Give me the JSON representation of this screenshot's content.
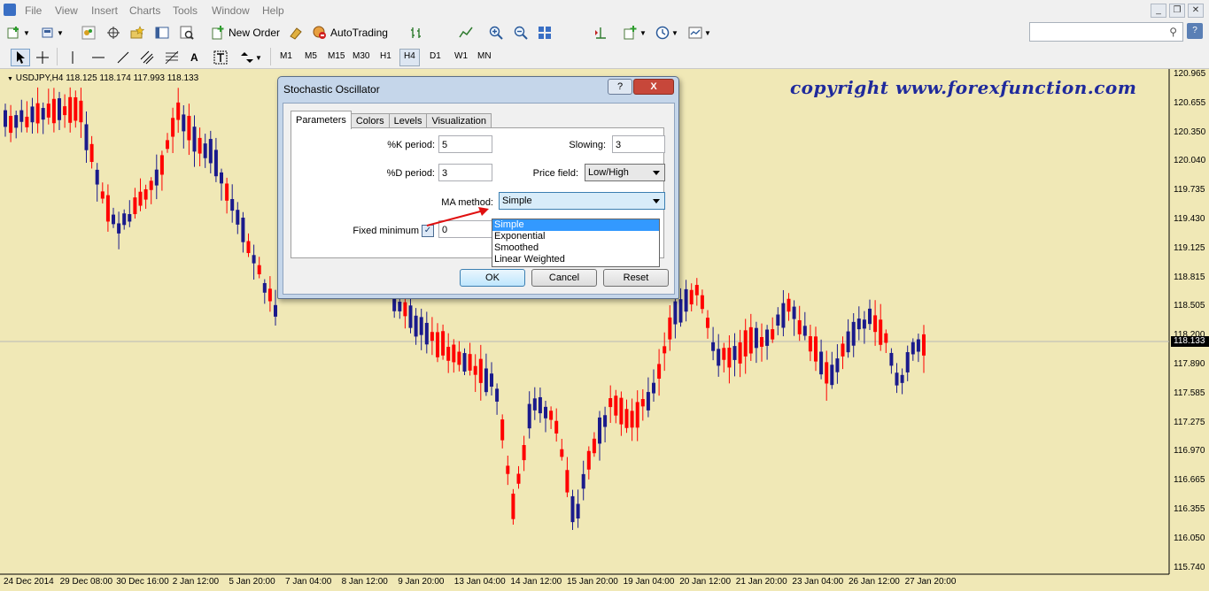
{
  "menu": {
    "items": [
      "File",
      "View",
      "Insert",
      "Charts",
      "Tools",
      "Window",
      "Help"
    ]
  },
  "toolbar": {
    "new_order": "New Order",
    "autotrading": "AutoTrading",
    "search_placeholder": ""
  },
  "timeframes": [
    "M1",
    "M5",
    "M15",
    "M30",
    "H1",
    "H4",
    "D1",
    "W1",
    "MN"
  ],
  "active_timeframe": "H4",
  "chart": {
    "symbol_info": "USDJPY,H4  118.125 118.174 117.993 118.133",
    "watermark": "copyright www.forexfunction.com",
    "current_price": "118.133",
    "price_labels": [
      "120.965",
      "120.655",
      "120.350",
      "120.040",
      "119.735",
      "119.430",
      "119.125",
      "118.815",
      "118.505",
      "118.200",
      "117.890",
      "117.585",
      "117.275",
      "116.970",
      "116.665",
      "116.355",
      "116.050",
      "115.740"
    ],
    "time_labels": [
      "24 Dec 2014",
      "29 Dec 08:00",
      "30 Dec 16:00",
      "2 Jan 12:00",
      "5 Jan 20:00",
      "7 Jan 04:00",
      "8 Jan 12:00",
      "9 Jan 20:00",
      "13 Jan 04:00",
      "14 Jan 12:00",
      "15 Jan 20:00",
      "19 Jan 04:00",
      "20 Jan 12:00",
      "21 Jan 20:00",
      "23 Jan 04:00",
      "26 Jan 12:00",
      "27 Jan 20:00"
    ],
    "colors": {
      "background": "#f0e8b6",
      "bull": "#1a1a8c",
      "bear": "#ff0000"
    }
  },
  "dialog": {
    "title": "Stochastic Oscillator",
    "help": "?",
    "close": "X",
    "tabs": [
      "Parameters",
      "Colors",
      "Levels",
      "Visualization"
    ],
    "active_tab": "Parameters",
    "k_period_label": "%K period:",
    "k_period": "5",
    "d_period_label": "%D period:",
    "d_period": "3",
    "slowing_label": "Slowing:",
    "slowing": "3",
    "price_field_label": "Price field:",
    "price_field": "Low/High",
    "ma_method_label": "MA method:",
    "ma_method": "Simple",
    "ma_options": [
      "Simple",
      "Exponential",
      "Smoothed",
      "Linear Weighted"
    ],
    "fixed_minimum_label": "Fixed minimum",
    "fixed_minimum_checked": true,
    "fixed_minimum": "0",
    "ok": "OK",
    "cancel": "Cancel",
    "reset": "Reset"
  }
}
